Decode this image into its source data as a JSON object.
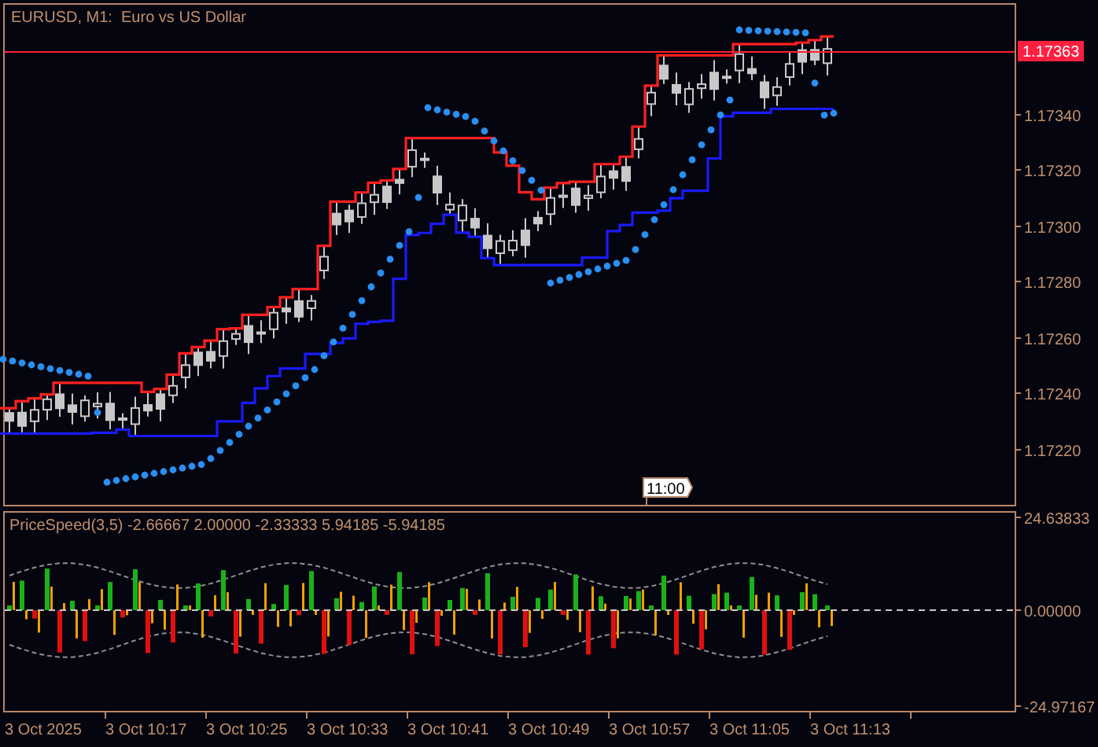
{
  "window": {
    "title": "EURUSD, M1:  Euro vs US Dollar"
  },
  "price_axis": {
    "labels": [
      "1.17340",
      "1.17320",
      "1.17300",
      "1.17280",
      "1.17260",
      "1.17240",
      "1.17220"
    ],
    "current_price": "1.17363"
  },
  "time_marker": "11:00",
  "indicator": {
    "label": "PriceSpeed(3,5) -2.66667 2.00000 -2.33333 5.94185 -5.94185",
    "axis_labels": [
      "24.63833",
      "0.00000",
      "-24.97167"
    ]
  },
  "time_axis": {
    "labels": [
      "3 Oct 2025",
      "3 Oct 10:17",
      "3 Oct 10:25",
      "3 Oct 10:33",
      "3 Oct 10:41",
      "3 Oct 10:49",
      "3 Oct 10:57",
      "3 Oct 11:05",
      "3 Oct 11:13"
    ]
  }
}
